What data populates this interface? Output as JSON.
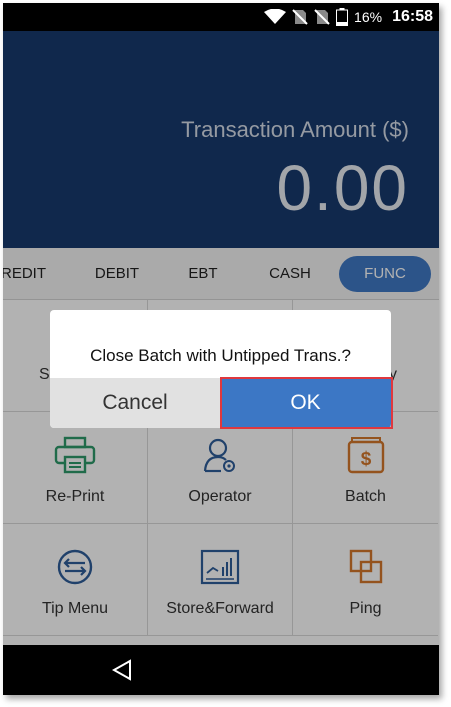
{
  "status_bar": {
    "battery_percent": "16%",
    "time": "16:58",
    "icons": [
      "wifi-icon",
      "no-sim-icon",
      "no-sim-icon",
      "battery-icon"
    ]
  },
  "header": {
    "amount_label": "Transaction Amount ($)",
    "amount_value": "0.00"
  },
  "tabs": [
    {
      "label": "REDIT",
      "active": false
    },
    {
      "label": "DEBIT",
      "active": false
    },
    {
      "label": "EBT",
      "active": false
    },
    {
      "label": "CASH",
      "active": false
    },
    {
      "label": "FUNC",
      "active": true
    }
  ],
  "grid": {
    "row1_partial": {
      "left_text": "S",
      "right_text": "y"
    },
    "items": [
      {
        "label": "Re-Print",
        "icon": "printer-icon"
      },
      {
        "label": "Operator",
        "icon": "operator-settings-icon"
      },
      {
        "label": "Batch",
        "icon": "batch-dollar-icon"
      },
      {
        "label": "Tip Menu",
        "icon": "tip-swap-icon"
      },
      {
        "label": "Store&Forward",
        "icon": "store-forward-chart-icon"
      },
      {
        "label": "Ping",
        "icon": "ping-squares-icon"
      }
    ]
  },
  "dialog": {
    "message": "Close Batch with Untipped Trans.?",
    "cancel_label": "Cancel",
    "ok_label": "OK"
  },
  "colors": {
    "header_bg": "#173a6e",
    "accent": "#3c77c5",
    "icon_green": "#2f9a6a",
    "icon_blue": "#2f5d9a",
    "icon_orange": "#d5782b",
    "highlight": "#e0383e"
  }
}
